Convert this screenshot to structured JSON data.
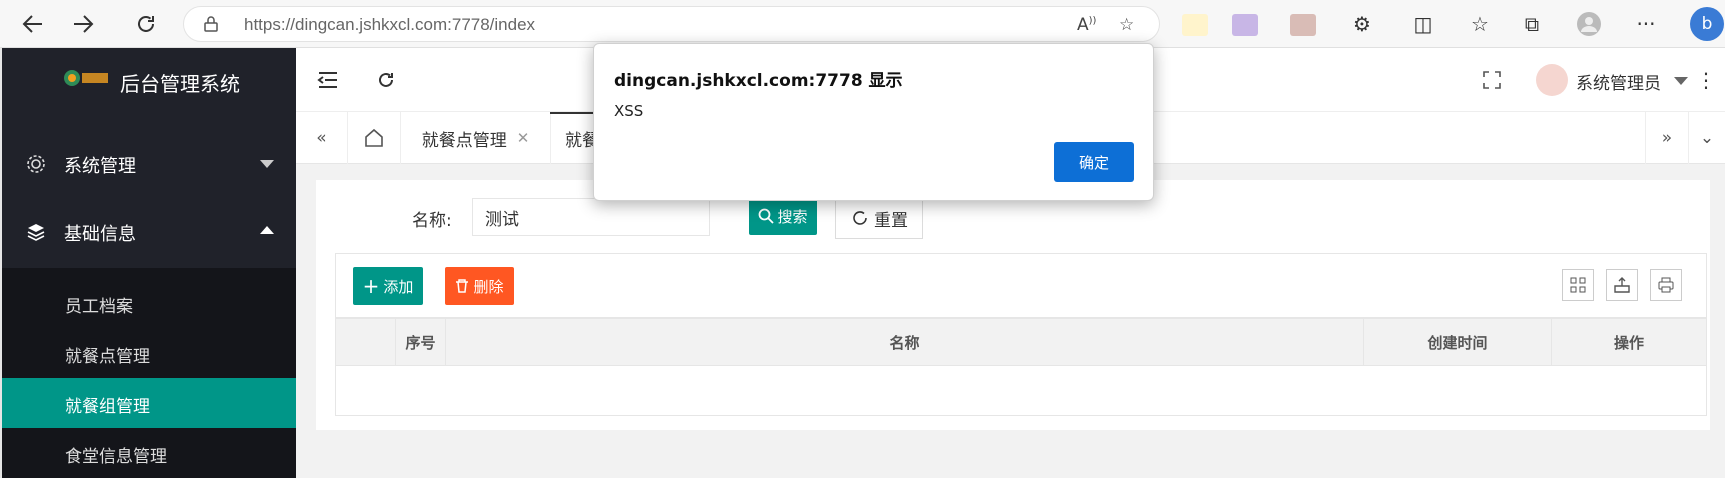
{
  "browser": {
    "url": "https://dingcan.jshkxcl.com:7778/index",
    "colors": {
      "bar": "#f7f7f7"
    }
  },
  "sidebar": {
    "app_title": "后台管理系统",
    "groups": [
      {
        "label": "系统管理",
        "icon": "gear-icon",
        "expanded": false
      },
      {
        "label": "基础信息",
        "icon": "layers-icon",
        "expanded": true
      }
    ],
    "items": [
      {
        "label": "员工档案",
        "active": false
      },
      {
        "label": "就餐点管理",
        "active": false
      },
      {
        "label": "就餐组管理",
        "active": true
      },
      {
        "label": "食堂信息管理",
        "active": false
      }
    ],
    "colors": {
      "bg": "#20222a",
      "active": "#009688"
    }
  },
  "header": {
    "user_name": "系统管理员"
  },
  "tabs": {
    "items": [
      {
        "label": "就餐点管理",
        "closable": true
      },
      {
        "label": "就餐",
        "closable": false
      }
    ]
  },
  "search": {
    "label": "名称:",
    "value": "测试",
    "search_button": "搜索",
    "reset_button": "重置"
  },
  "toolbar": {
    "add_label": "添加",
    "delete_label": "删除"
  },
  "table": {
    "columns": [
      "序号",
      "名称",
      "创建时间",
      "操作"
    ],
    "rows": []
  },
  "dialog": {
    "title": "dingcan.jshkxcl.com:7778 显示",
    "message": "XSS",
    "ok_label": "确定",
    "accent": "#0d6fd6"
  }
}
